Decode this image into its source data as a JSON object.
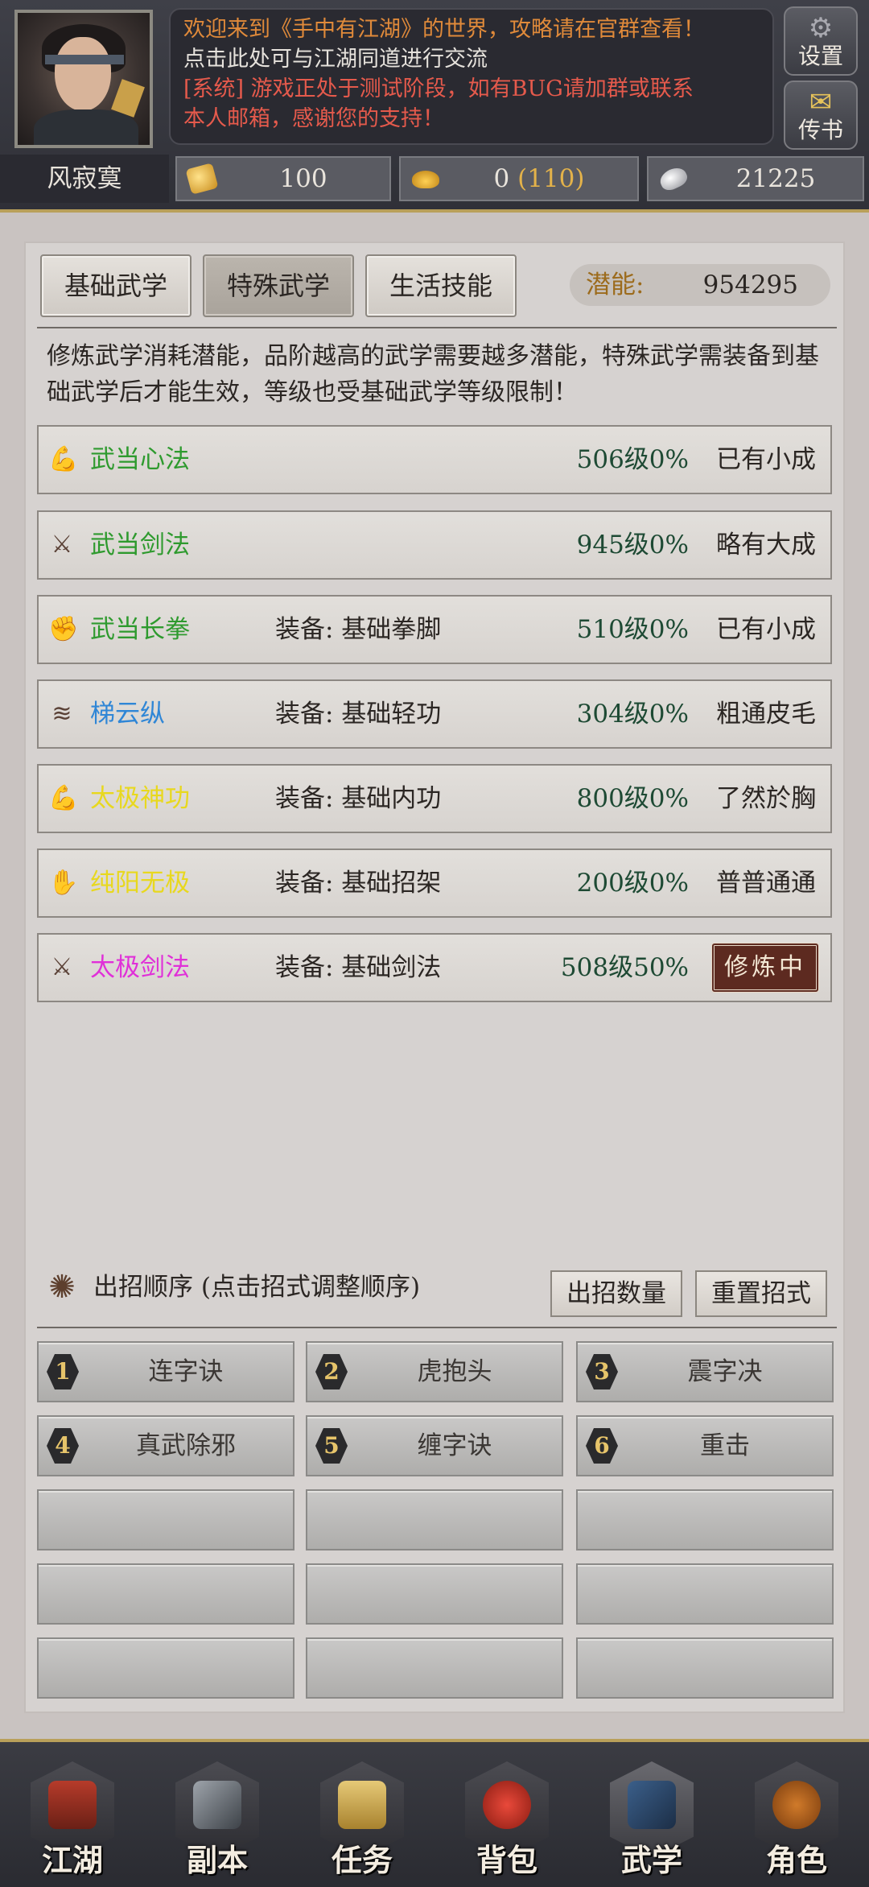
{
  "header": {
    "welcome": "欢迎来到《手中有江湖》的世界，攻略请在官群查看！",
    "chat": "点击此处可与江湖同道进行交流",
    "system_line1": "[系统] 游戏正处于测试阶段，如有BUG请加群或联系",
    "system_line2": "本人邮箱，感谢您的支持！",
    "settings_label": "设置",
    "mail_label": "传书",
    "player_name": "风寂寞",
    "currency_coin": "100",
    "currency_gold": "0",
    "currency_gold_bonus": "(110)",
    "currency_silver": "21225"
  },
  "tabs": [
    "基础武学",
    "特殊武学",
    "生活技能"
  ],
  "potential": {
    "label": "潜能:",
    "value": "954295"
  },
  "description": "修炼武学消耗潜能，品阶越高的武学需要越多潜能，特殊武学需装备到基础武学后才能生效，等级也受基础武学等级限制！",
  "skills": [
    {
      "name": "武当心法",
      "equip": "",
      "level": "506级0%",
      "status": "已有小成",
      "color": "#2e9a2e",
      "icon": "strength-icon"
    },
    {
      "name": "武当剑法",
      "equip": "",
      "level": "945级0%",
      "status": "略有大成",
      "color": "#2e9a2e",
      "icon": "sword-icon"
    },
    {
      "name": "武当长拳",
      "equip": "装备: 基础拳脚",
      "level": "510级0%",
      "status": "已有小成",
      "color": "#2e9a2e",
      "icon": "fist-icon"
    },
    {
      "name": "梯云纵",
      "equip": "装备: 基础轻功",
      "level": "304级0%",
      "status": "粗通皮毛",
      "color": "#2f86d6",
      "icon": "wing-icon"
    },
    {
      "name": "太极神功",
      "equip": "装备: 基础内功",
      "level": "800级0%",
      "status": "了然於胸",
      "color": "#e8d81e",
      "icon": "strength-icon"
    },
    {
      "name": "纯阳无极",
      "equip": "装备: 基础招架",
      "level": "200级0%",
      "status": "普普通通",
      "color": "#e8d81e",
      "icon": "arm-icon"
    },
    {
      "name": "太极剑法",
      "equip": "装备: 基础剑法",
      "level": "508级50%",
      "status": "修炼中",
      "color": "#e030d8",
      "icon": "sword-icon"
    }
  ],
  "order": {
    "title": "出招顺序 (点击招式调整顺序)",
    "count_button": "出招数量",
    "reset_button": "重置招式"
  },
  "moves": [
    {
      "num": "1",
      "name": "连字诀"
    },
    {
      "num": "2",
      "name": "虎抱头"
    },
    {
      "num": "3",
      "name": "震字决"
    },
    {
      "num": "4",
      "name": "真武除邪"
    },
    {
      "num": "5",
      "name": "缠字诀"
    },
    {
      "num": "6",
      "name": "重击"
    }
  ],
  "nav": [
    "江湖",
    "副本",
    "任务",
    "背包",
    "武学",
    "角色"
  ]
}
